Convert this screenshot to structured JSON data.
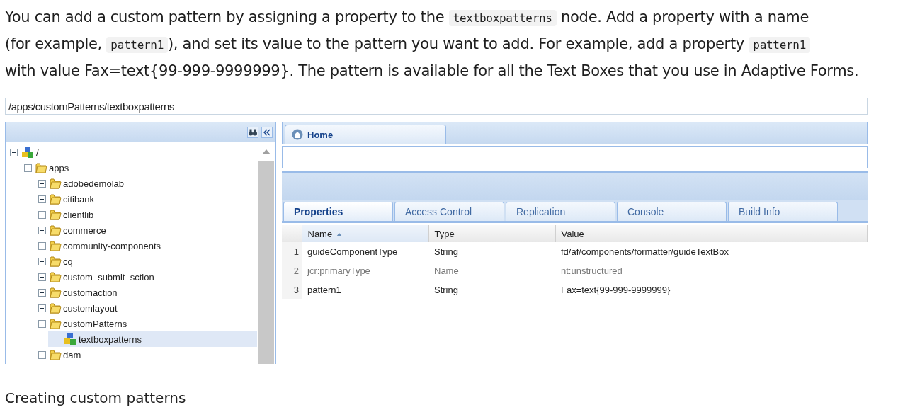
{
  "intro": {
    "lines": [
      [
        {
          "kind": "text",
          "text": "You can add a custom pattern by assigning a property to the "
        },
        {
          "kind": "code",
          "text": "textboxpatterns"
        },
        {
          "kind": "text",
          "text": " node. Add a property with a name"
        }
      ],
      [
        {
          "kind": "text",
          "text": "(for example, "
        },
        {
          "kind": "code",
          "text": "pattern1"
        },
        {
          "kind": "text",
          "text": "), and set its value to the pattern you want to add. For example, add a property "
        },
        {
          "kind": "code",
          "text": "pattern1"
        }
      ],
      [
        {
          "kind": "text",
          "text": "with value Fax=text{99-999-9999999}. The pattern is available for all the Text Boxes that you use in Adaptive Forms."
        }
      ]
    ]
  },
  "screenshot": {
    "path": "/apps/customPatterns/textboxpatterns",
    "tree": [
      {
        "label": "/",
        "kind": "node",
        "expanded": true,
        "selected": false,
        "children": [
          {
            "label": "apps",
            "kind": "folder",
            "expanded": true,
            "selected": false,
            "children": [
              {
                "label": "adobedemolab",
                "kind": "folder",
                "expanded": false,
                "selected": false
              },
              {
                "label": "citibank",
                "kind": "folder",
                "expanded": false,
                "selected": false
              },
              {
                "label": "clientlib",
                "kind": "folder",
                "expanded": false,
                "selected": false
              },
              {
                "label": "commerce",
                "kind": "folder",
                "expanded": false,
                "selected": false
              },
              {
                "label": "community-components",
                "kind": "folder",
                "expanded": false,
                "selected": false
              },
              {
                "label": "cq",
                "kind": "folder",
                "expanded": false,
                "selected": false
              },
              {
                "label": "custom_submit_sction",
                "kind": "folder",
                "expanded": false,
                "selected": false
              },
              {
                "label": "customaction",
                "kind": "folder",
                "expanded": false,
                "selected": false
              },
              {
                "label": "customlayout",
                "kind": "folder",
                "expanded": false,
                "selected": false
              },
              {
                "label": "customPatterns",
                "kind": "folder",
                "expanded": true,
                "selected": false,
                "children": [
                  {
                    "label": "textboxpatterns",
                    "kind": "node",
                    "selected": true
                  }
                ]
              },
              {
                "label": "dam",
                "kind": "folder",
                "expanded": false,
                "selected": false
              }
            ]
          }
        ]
      }
    ],
    "editor_tab": {
      "label": "Home"
    },
    "tabs": [
      {
        "label": "Properties",
        "selected": true
      },
      {
        "label": "Access Control",
        "selected": false
      },
      {
        "label": "Replication",
        "selected": false
      },
      {
        "label": "Console",
        "selected": false
      },
      {
        "label": "Build Info",
        "selected": false
      }
    ],
    "table": {
      "columns": [
        {
          "label": "Name",
          "sorted": true
        },
        {
          "label": "Type",
          "sorted": false
        },
        {
          "label": "Value",
          "sorted": false
        }
      ],
      "rows": [
        {
          "index": "1",
          "cells": [
            "guideComponentType",
            "String",
            "fd/af/components/formatter/guideTextBox"
          ],
          "protected": false
        },
        {
          "index": "2",
          "cells": [
            "jcr:primaryType",
            "Name",
            "nt:unstructured"
          ],
          "protected": true
        },
        {
          "index": "3",
          "cells": [
            "pattern1",
            "String",
            "Fax=text{99-999-9999999}"
          ],
          "protected": false
        }
      ]
    }
  },
  "caption": "Creating custom patterns"
}
